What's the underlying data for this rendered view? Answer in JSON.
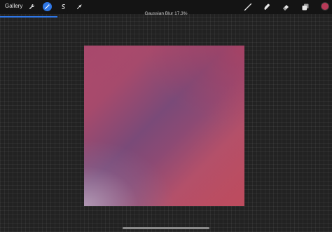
{
  "toolbar": {
    "gallery_label": "Gallery",
    "left_tools": [
      {
        "icon": "wrench-icon"
      },
      {
        "icon": "magic-wand-icon",
        "active": true
      },
      {
        "icon": "selection-icon"
      },
      {
        "icon": "transform-arrow-icon"
      }
    ],
    "right_tools": [
      {
        "icon": "brush-icon"
      },
      {
        "icon": "smudge-icon"
      },
      {
        "icon": "eraser-icon"
      },
      {
        "icon": "layers-icon"
      }
    ],
    "current_color": "#b83a58",
    "accent_color": "#2f77e6"
  },
  "adjustment": {
    "status_text": "Gaussian Blur 17.3%",
    "percent": 17.3
  }
}
